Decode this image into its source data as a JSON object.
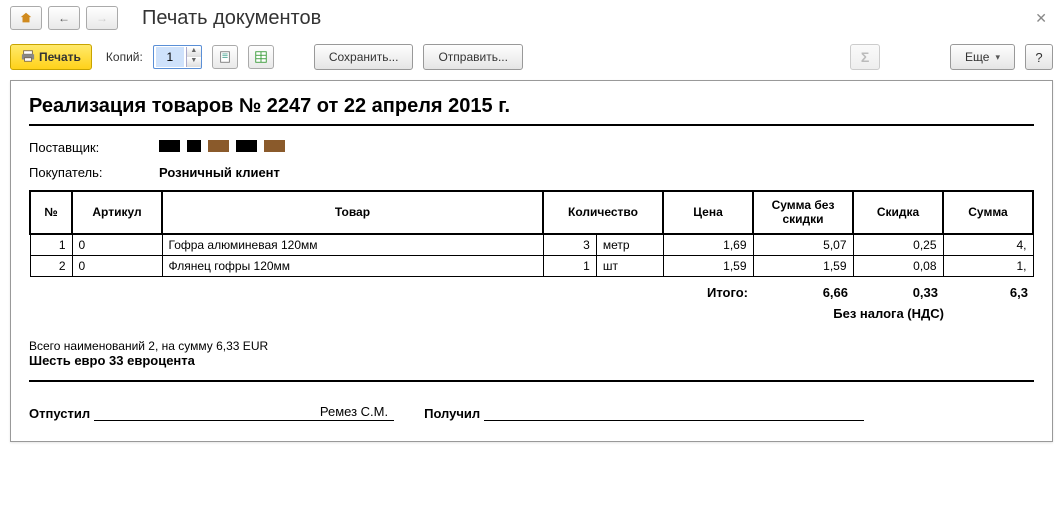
{
  "header": {
    "title": "Печать документов"
  },
  "toolbar": {
    "print_label": "Печать",
    "copies_label": "Копий:",
    "copies_value": "1",
    "save_label": "Сохранить...",
    "send_label": "Отправить...",
    "more_label": "Еще",
    "help_label": "?"
  },
  "doc": {
    "title": "Реализация товаров № 2247 от 22 апреля 2015 г.",
    "supplier_label": "Поставщик:",
    "buyer_label": "Покупатель:",
    "buyer_value": "Розничный клиент",
    "cols": {
      "num": "№",
      "article": "Артикул",
      "product": "Товар",
      "qty": "Количество",
      "price": "Цена",
      "sum_no_disc": "Сумма без скидки",
      "discount": "Скидка",
      "sum": "Сумма"
    },
    "rows": [
      {
        "n": "1",
        "art": "0",
        "name": "Гофра алюминевая 120мм",
        "qty": "3",
        "unit": "метр",
        "price": "1,69",
        "sum_nd": "5,07",
        "disc": "0,25",
        "sum": "4,"
      },
      {
        "n": "2",
        "art": "0",
        "name": "Флянец гофры 120мм",
        "qty": "1",
        "unit": "шт",
        "price": "1,59",
        "sum_nd": "1,59",
        "disc": "0,08",
        "sum": "1,"
      }
    ],
    "totals": {
      "label": "Итого:",
      "sum_nd": "6,66",
      "disc": "0,33",
      "sum": "6,3"
    },
    "no_tax": "Без налога (НДС)",
    "summary": "Всего наименований 2, на сумму 6,33 EUR",
    "summary_words": "Шесть евро 33 евроцента",
    "released_label": "Отпустил",
    "released_name": "Ремез С.М.",
    "received_label": "Получил"
  }
}
